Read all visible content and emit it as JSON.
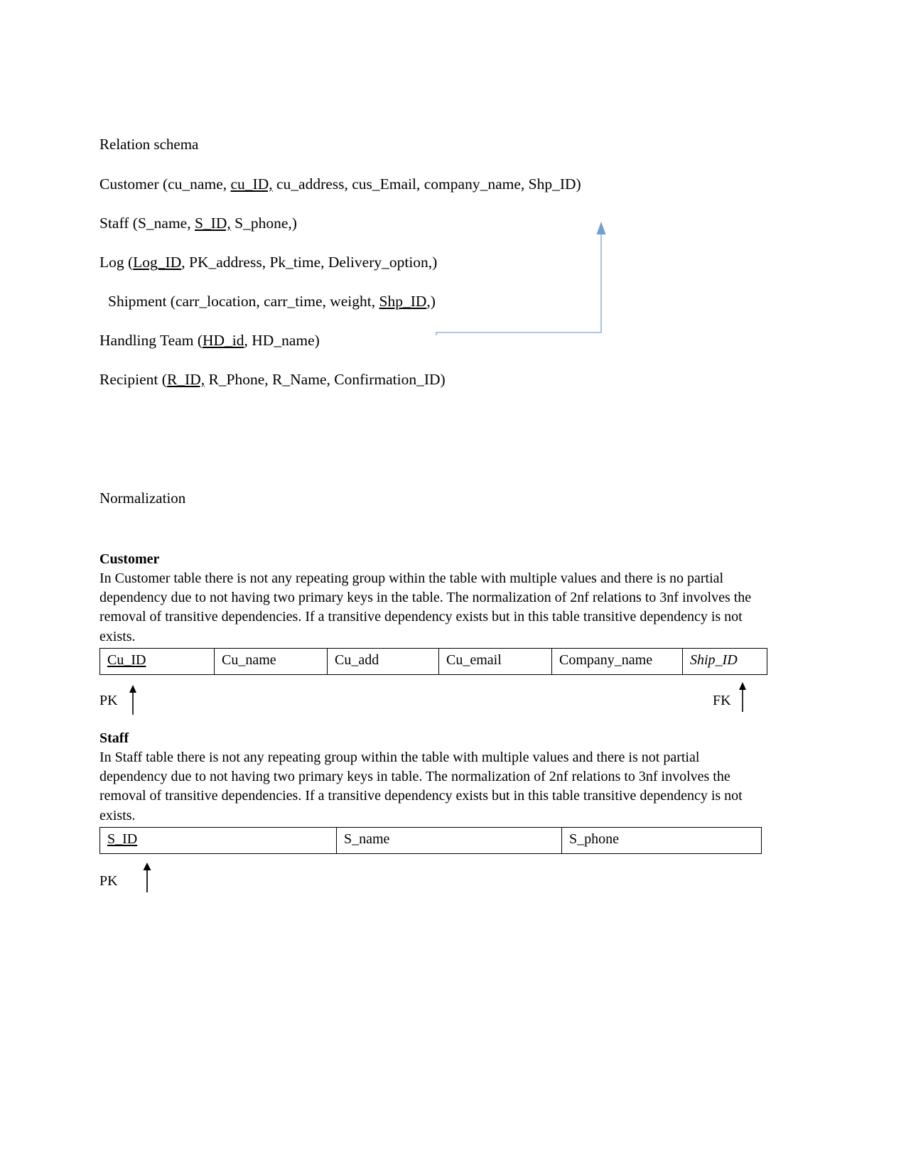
{
  "document": {
    "schema_section": {
      "heading": "Relation schema",
      "relations": [
        {
          "prefix": "Customer (cu_name, ",
          "key": "cu_ID,",
          "suffix": " cu_address, cus_Email, company_name, Shp_ID)",
          "indent": false
        },
        {
          "prefix": "Staff (S_name, ",
          "key": "S_ID,",
          "suffix": " S_phone,)",
          "indent": false
        },
        {
          "prefix": "Log (",
          "key": "Log_ID",
          "suffix": ", PK_address, Pk_time, Delivery_option,)",
          "indent": false
        },
        {
          "prefix": "Shipment (carr_location, carr_time, weight, ",
          "key": "Shp_ID",
          "suffix": ",)",
          "indent": true
        },
        {
          "prefix": "Handling Team (",
          "key": "HD_id",
          "suffix": ", HD_name)",
          "indent": false
        },
        {
          "prefix": "Recipient (",
          "key": "R_ID,",
          "suffix": " R_Phone, R_Name, Confirmation_ID)",
          "indent": false
        }
      ],
      "connector": {
        "name": "shp-id-foreign-key-connector",
        "color": "#8DB3D9"
      }
    },
    "normalization_section": {
      "heading": "Normalization",
      "subsections": [
        {
          "title": "Customer",
          "body": "In Customer table there is not any repeating group within the table with multiple values and there is no partial dependency due to not having two primary keys in the table. The normalization of 2nf relations to 3nf involves the removal of transitive dependencies. If a transitive dependency exists but in this table transitive dependency is not exists.",
          "columns": [
            {
              "label": "Cu_ID",
              "style": "pk"
            },
            {
              "label": "Cu_name",
              "style": "plain"
            },
            {
              "label": "Cu_add",
              "style": "plain"
            },
            {
              "label": "Cu_email",
              "style": "plain"
            },
            {
              "label": "Company_name",
              "style": "plain"
            },
            {
              "label": "Ship_ID",
              "style": "fk"
            }
          ],
          "keys": [
            {
              "label": "PK",
              "target": "Cu_ID"
            },
            {
              "label": "FK",
              "target": "Ship_ID"
            }
          ]
        },
        {
          "title": "Staff",
          "body": "In Staff table there is not any repeating group within the table with multiple values and there is not partial dependency due to not having two primary keys in table. The normalization of 2nf relations to 3nf involves the removal of transitive dependencies. If a transitive dependency exists but in this table transitive dependency is not exists.",
          "columns": [
            {
              "label": "S_ID",
              "style": "pk"
            },
            {
              "label": "S_name",
              "style": "plain"
            },
            {
              "label": "S_phone",
              "style": "plain"
            }
          ],
          "keys": [
            {
              "label": "PK",
              "target": "S_ID"
            }
          ]
        }
      ]
    }
  }
}
